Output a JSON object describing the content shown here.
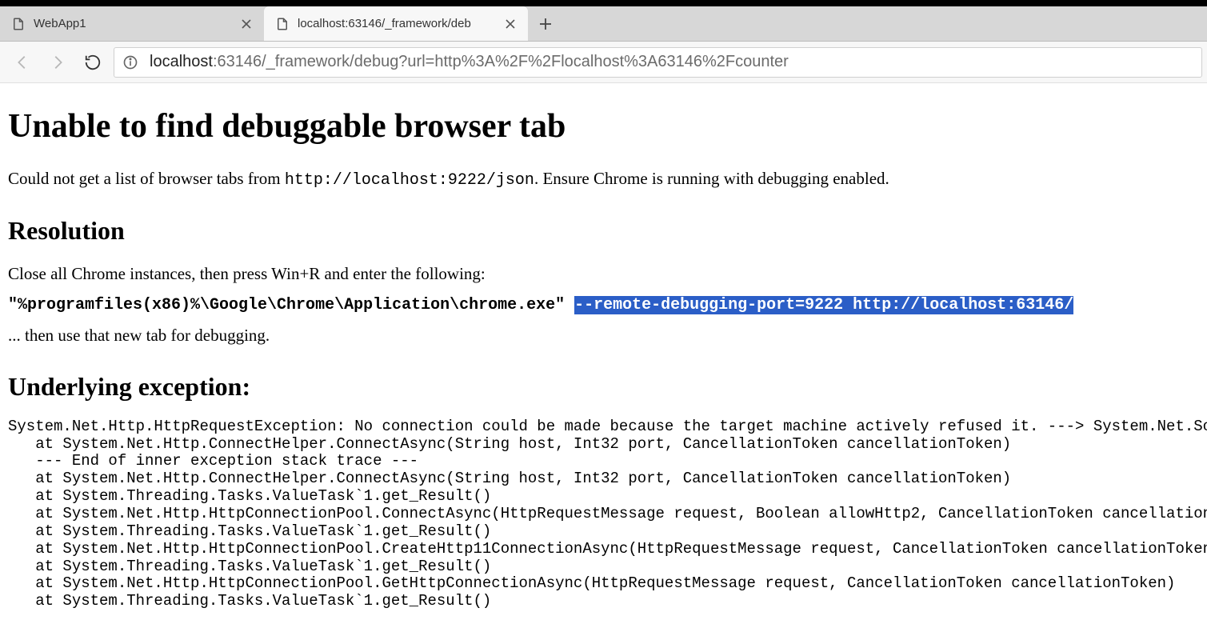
{
  "browser": {
    "tabs": [
      {
        "label": "WebApp1",
        "active": false
      },
      {
        "label": "localhost:63146/_framework/deb",
        "active": true
      }
    ],
    "address_host": "localhost",
    "address_rest": ":63146/_framework/debug?url=http%3A%2F%2Flocalhost%3A63146%2Fcounter"
  },
  "page": {
    "h1": "Unable to find debuggable browser tab",
    "p1_prefix": "Could not get a list of browser tabs from ",
    "p1_code": "http://localhost:9222/json",
    "p1_suffix": ". Ensure Chrome is running with debugging enabled.",
    "h2_resolution": "Resolution",
    "p2": "Close all Chrome instances, then press Win+R and enter the following:",
    "cmd_plain": "\"%programfiles(x86)%\\Google\\Chrome\\Application\\chrome.exe\" ",
    "cmd_selected": "--remote-debugging-port=9222 http://localhost:63146/",
    "p3": "... then use that new tab for debugging.",
    "h2_exception": "Underlying exception:",
    "stacktrace": "System.Net.Http.HttpRequestException: No connection could be made because the target machine actively refused it. ---> System.Net.Sockets.SocketExcep\n   at System.Net.Http.ConnectHelper.ConnectAsync(String host, Int32 port, CancellationToken cancellationToken)\n   --- End of inner exception stack trace ---\n   at System.Net.Http.ConnectHelper.ConnectAsync(String host, Int32 port, CancellationToken cancellationToken)\n   at System.Threading.Tasks.ValueTask`1.get_Result()\n   at System.Net.Http.HttpConnectionPool.ConnectAsync(HttpRequestMessage request, Boolean allowHttp2, CancellationToken cancellationToken)\n   at System.Threading.Tasks.ValueTask`1.get_Result()\n   at System.Net.Http.HttpConnectionPool.CreateHttp11ConnectionAsync(HttpRequestMessage request, CancellationToken cancellationToken)\n   at System.Threading.Tasks.ValueTask`1.get_Result()\n   at System.Net.Http.HttpConnectionPool.GetHttpConnectionAsync(HttpRequestMessage request, CancellationToken cancellationToken)\n   at System.Threading.Tasks.ValueTask`1.get_Result()"
  }
}
